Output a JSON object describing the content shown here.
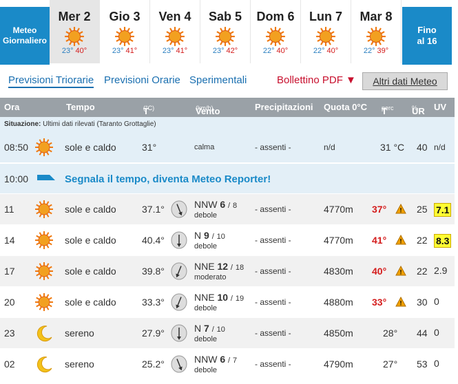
{
  "strip": {
    "meteo_label_1": "Meteo",
    "meteo_label_2": "Giornaliero",
    "days": [
      {
        "name": "Mer 2",
        "min": "23°",
        "max": "40°"
      },
      {
        "name": "Gio 3",
        "min": "23°",
        "max": "41°"
      },
      {
        "name": "Ven 4",
        "min": "23°",
        "max": "41°"
      },
      {
        "name": "Sab 5",
        "min": "23°",
        "max": "42°"
      },
      {
        "name": "Dom 6",
        "min": "22°",
        "max": "40°"
      },
      {
        "name": "Lun 7",
        "min": "22°",
        "max": "40°"
      },
      {
        "name": "Mar 8",
        "min": "22°",
        "max": "39°"
      }
    ],
    "fino_1": "Fino",
    "fino_2": "al 16"
  },
  "tabs": {
    "triorarie": "Previsioni Triorarie",
    "orarie": "Previsioni Orarie",
    "sperimentali": "Sperimentali",
    "pdf": "Bollettino PDF",
    "pdf_arrow": "▼",
    "altri": "Altri dati Meteo"
  },
  "header": {
    "ora": "Ora",
    "tempo": "Tempo",
    "t": "T",
    "t_unit": "(°C)",
    "vento": "Vento",
    "vento_unit": "(km/h)",
    "precip": "Precipitazioni",
    "quota": "Quota 0°C",
    "tperc": "T",
    "tperc_sub": "perc",
    "ur": "UR",
    "ur_unit": "%",
    "uv": "UV"
  },
  "situazione": {
    "label": "Situazione:",
    "text": "Ultimi dati rilevati (Taranto Grottaglie)"
  },
  "current": {
    "ora": "08:50",
    "tempo": "sole e caldo",
    "t": "31°",
    "vento": "calma",
    "prec": "- assenti -",
    "quota": "n/d",
    "tperc": "31 °C",
    "ur": "40",
    "uv": "n/d"
  },
  "reporter": {
    "ora": "10:00",
    "text": "Segnala il tempo, diventa Meteo Reporter!"
  },
  "rows": [
    {
      "ora": "11",
      "icon": "sun-icon",
      "tempo": "sole e caldo",
      "t": "37.1°",
      "dir": "NNW",
      "speed": "6",
      "gust": "8",
      "desc": "debole",
      "prec": "- assenti -",
      "quota": "4770m",
      "tperc": "37°",
      "warn": true,
      "ur": "25",
      "uv": "7.1",
      "uv_box": true
    },
    {
      "ora": "14",
      "icon": "sun-icon",
      "tempo": "sole e caldo",
      "t": "40.4°",
      "dir": "N",
      "speed": "9",
      "gust": "10",
      "desc": "debole",
      "prec": "- assenti -",
      "quota": "4770m",
      "tperc": "41°",
      "warn": true,
      "ur": "22",
      "uv": "8.3",
      "uv_box": true
    },
    {
      "ora": "17",
      "icon": "sun-icon",
      "tempo": "sole e caldo",
      "t": "39.8°",
      "dir": "NNE",
      "speed": "12",
      "gust": "18",
      "desc": "moderato",
      "prec": "- assenti -",
      "quota": "4830m",
      "tperc": "40°",
      "warn": true,
      "ur": "22",
      "uv": "2.9",
      "uv_box": false
    },
    {
      "ora": "20",
      "icon": "sun-icon",
      "tempo": "sole e caldo",
      "t": "33.3°",
      "dir": "NNE",
      "speed": "10",
      "gust": "19",
      "desc": "debole",
      "prec": "- assenti -",
      "quota": "4880m",
      "tperc": "33°",
      "warn": true,
      "ur": "30",
      "uv": "0",
      "uv_box": false
    },
    {
      "ora": "23",
      "icon": "moon-icon",
      "tempo": "sereno",
      "t": "27.9°",
      "dir": "N",
      "speed": "7",
      "gust": "10",
      "desc": "debole",
      "prec": "- assenti -",
      "quota": "4850m",
      "tperc": "28°",
      "warn": false,
      "ur": "44",
      "uv": "0",
      "uv_box": false
    },
    {
      "ora": "02",
      "icon": "moon-icon",
      "tempo": "sereno",
      "t": "25.2°",
      "dir": "NNW",
      "speed": "6",
      "gust": "7",
      "desc": "debole",
      "prec": "- assenti -",
      "quota": "4790m",
      "tperc": "27°",
      "warn": false,
      "ur": "53",
      "uv": "0",
      "uv_box": false
    }
  ],
  "colors": {
    "accent": "#1a8ac8",
    "header_bg": "#9aa1a7",
    "warn": "#f0a000",
    "uv_high": "#ffff33",
    "tmax": "#d41c1c",
    "tmin": "#2a7fc0"
  }
}
